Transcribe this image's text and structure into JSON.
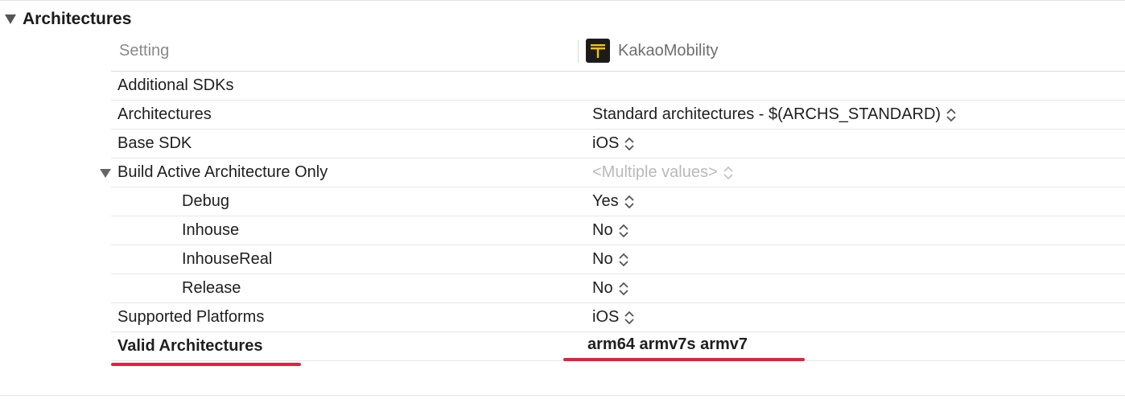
{
  "section": {
    "title": "Architectures"
  },
  "table": {
    "header": {
      "setting_label": "Setting",
      "target_name": "KakaoMobility",
      "target_icon": "kakao-t-app-icon",
      "icon_color": "#f5c400"
    },
    "rows": [
      {
        "label": "Additional SDKs",
        "value": ""
      },
      {
        "label": "Architectures",
        "value": "Standard architectures  -  $(ARCHS_STANDARD)"
      },
      {
        "label": "Base SDK",
        "value": "iOS"
      },
      {
        "label": "Build Active Architecture Only",
        "value": "<Multiple values>"
      },
      {
        "label": "Debug",
        "value": "Yes"
      },
      {
        "label": "Inhouse",
        "value": "No"
      },
      {
        "label": "InhouseReal",
        "value": "No"
      },
      {
        "label": "Release",
        "value": "No"
      },
      {
        "label": "Supported Platforms",
        "value": "iOS"
      },
      {
        "label": "Valid Architectures",
        "value": "arm64 armv7s armv7"
      }
    ]
  },
  "highlight_color": "#e8203c"
}
